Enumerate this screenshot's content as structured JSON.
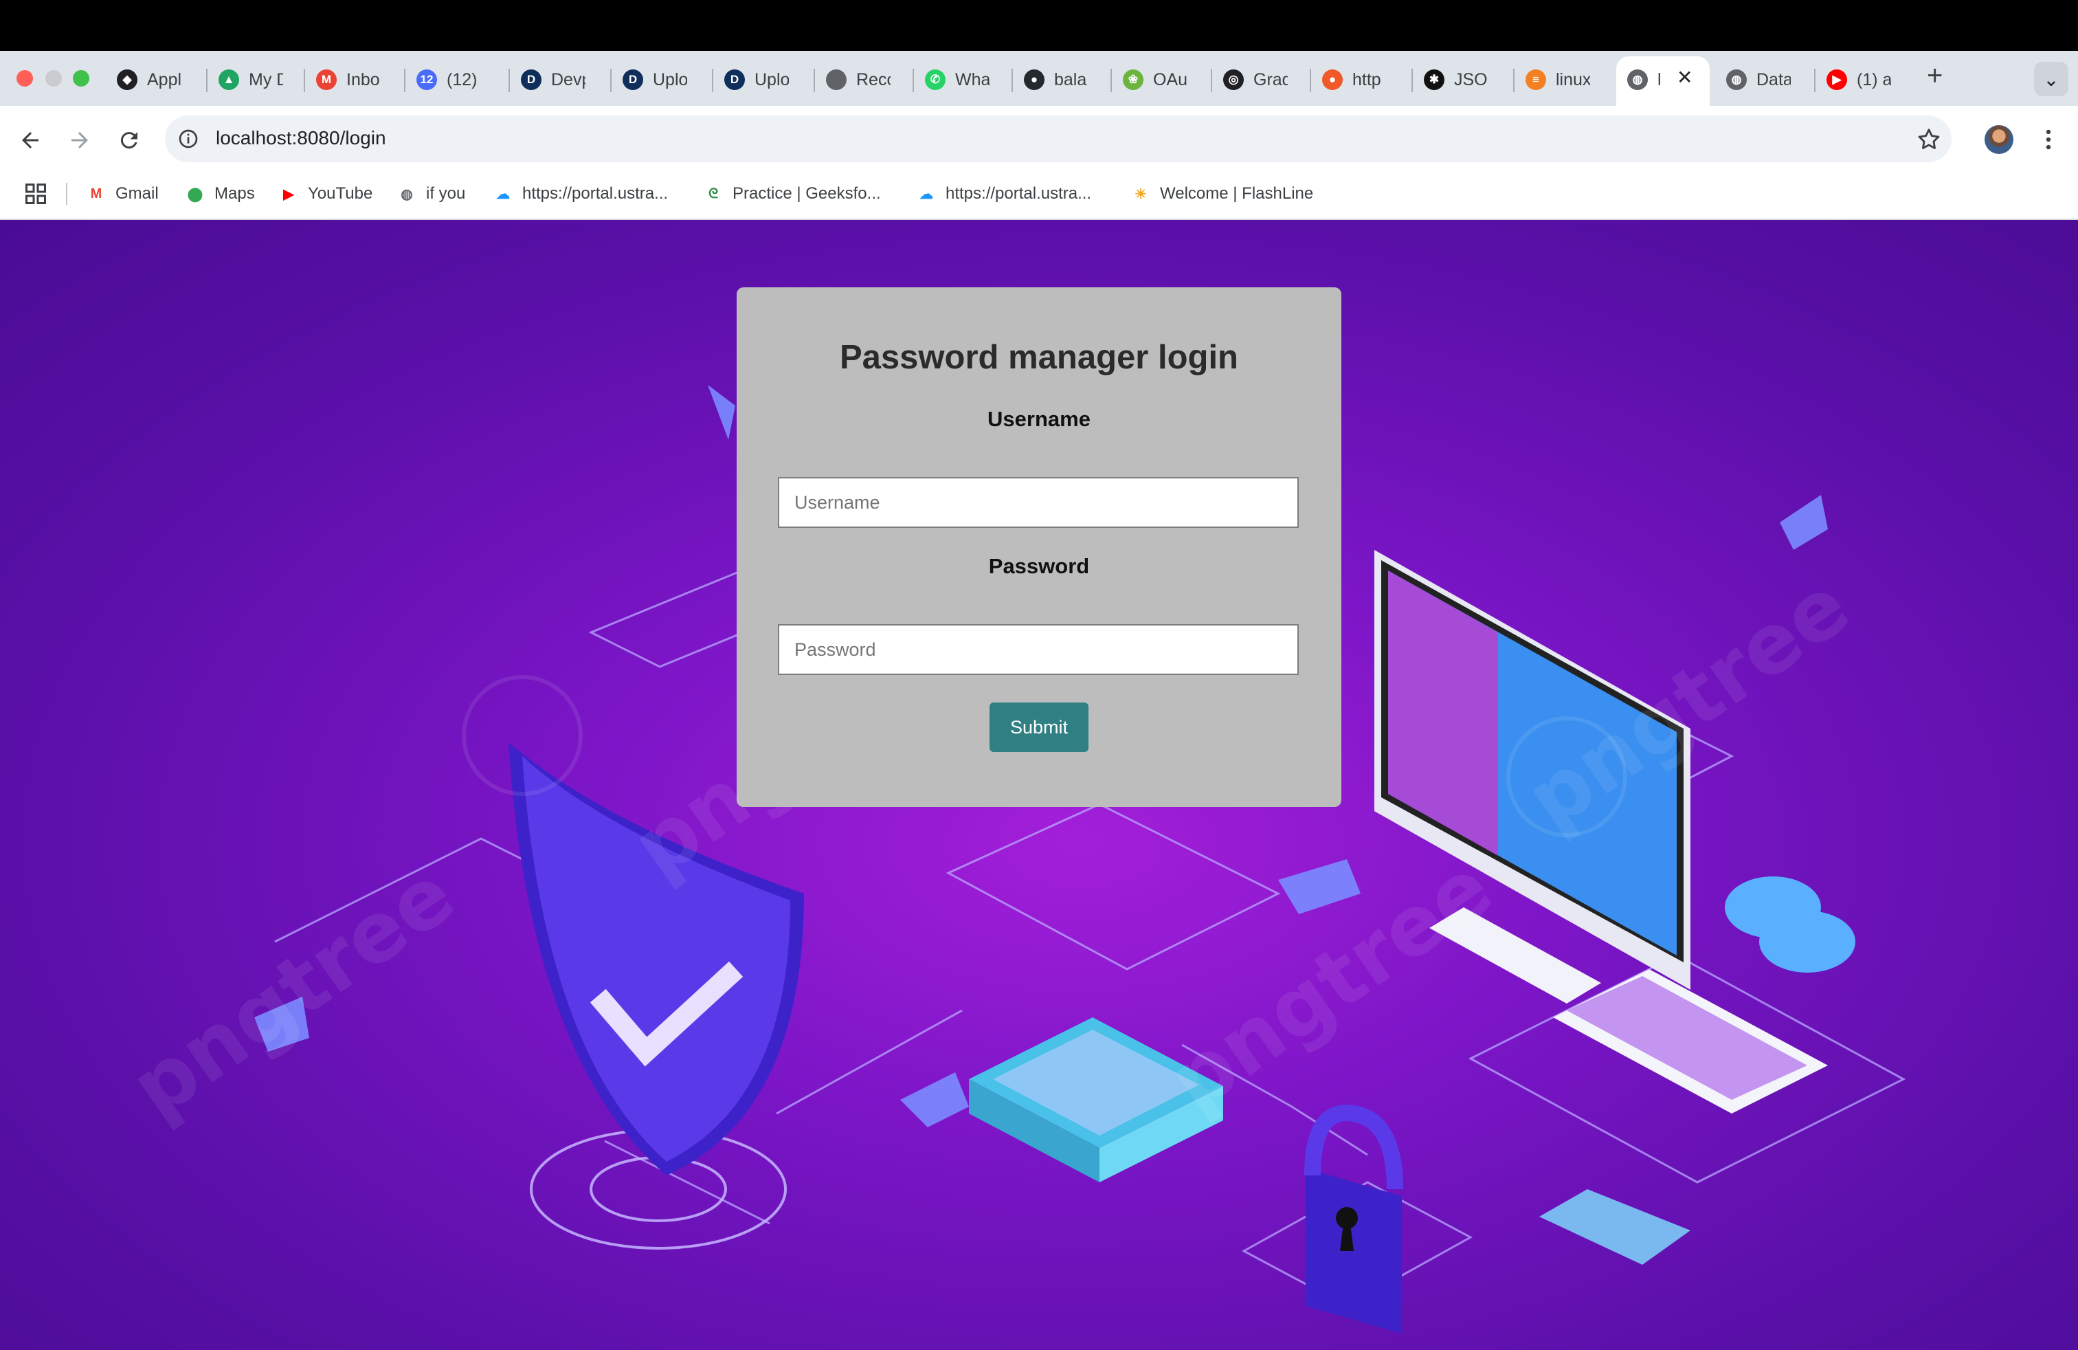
{
  "browser": {
    "tabs": [
      {
        "label": "Appl",
        "fav_color": "#202124",
        "fav_glyph": "◆",
        "icon": "shield-icon"
      },
      {
        "label": "My D",
        "fav_color": "#1fa463",
        "fav_glyph": "▲",
        "icon": "drive-icon"
      },
      {
        "label": "Inbo",
        "fav_color": "#ea4335",
        "fav_glyph": "M",
        "icon": "gmail-icon"
      },
      {
        "label": "(12)",
        "fav_color": "#4a6cf7",
        "fav_glyph": "12",
        "icon": "notification-icon"
      },
      {
        "label": "Devp",
        "fav_color": "#0f2e5a",
        "fav_glyph": "D",
        "icon": "d-icon"
      },
      {
        "label": "Uplo",
        "fav_color": "#0f2e5a",
        "fav_glyph": "D",
        "icon": "d-icon"
      },
      {
        "label": "Uplo",
        "fav_color": "#0f2e5a",
        "fav_glyph": "D",
        "icon": "d-icon"
      },
      {
        "label": "Reco",
        "fav_color": "#5f6368",
        "fav_glyph": "",
        "icon": "apple-icon"
      },
      {
        "label": "Wha",
        "fav_color": "#25d366",
        "fav_glyph": "✆",
        "icon": "whatsapp-icon"
      },
      {
        "label": "bala",
        "fav_color": "#24292e",
        "fav_glyph": "●",
        "icon": "github-icon"
      },
      {
        "label": "OAut",
        "fav_color": "#6db33f",
        "fav_glyph": "❀",
        "icon": "spring-icon"
      },
      {
        "label": "Grad",
        "fav_color": "#202124",
        "fav_glyph": "◎",
        "icon": "openai-icon"
      },
      {
        "label": "http",
        "fav_color": "#f05a28",
        "fav_glyph": "●",
        "icon": "postman-icon"
      },
      {
        "label": "JSO",
        "fav_color": "#111111",
        "fav_glyph": "✱",
        "icon": "json-icon"
      },
      {
        "label": "linux",
        "fav_color": "#f48024",
        "fav_glyph": "≡",
        "icon": "stackoverflow-icon"
      },
      {
        "label": "l",
        "fav_color": "#5f6368",
        "fav_glyph": "◍",
        "icon": "globe-icon"
      },
      {
        "label": "Data",
        "fav_color": "#5f6368",
        "fav_glyph": "◍",
        "icon": "globe-icon"
      },
      {
        "label": "(1) a",
        "fav_color": "#ff0000",
        "fav_glyph": "▶",
        "icon": "youtube-icon"
      }
    ],
    "new_tab_glyph": "+",
    "tab_menu_glyph": "⌄",
    "close_glyph": "✕",
    "url": "localhost:8080/login",
    "bookmarks": [
      {
        "label": "Gmail",
        "glyph": "M",
        "color": "#ea4335",
        "icon": "gmail-icon"
      },
      {
        "label": "Maps",
        "glyph": "⬤",
        "color": "#34a853",
        "icon": "maps-pin-icon"
      },
      {
        "label": "YouTube",
        "glyph": "▶",
        "color": "#ff0000",
        "icon": "youtube-icon"
      },
      {
        "label": "if you",
        "glyph": "◍",
        "color": "#5f6368",
        "icon": "globe-icon"
      },
      {
        "label": "https://portal.ustra...",
        "glyph": "☁",
        "color": "#1b96ff",
        "icon": "cloud-icon"
      },
      {
        "label": "Practice | Geeksfo...",
        "glyph": "ᘓ",
        "color": "#2f8d46",
        "icon": "geeksforgeeks-icon"
      },
      {
        "label": "https://portal.ustra...",
        "glyph": "☁",
        "color": "#1b96ff",
        "icon": "cloud-icon"
      },
      {
        "label": "Welcome | FlashLine",
        "glyph": "☀",
        "color": "#f4a81d",
        "icon": "sun-icon"
      }
    ]
  },
  "login": {
    "title": "Password manager login",
    "username_label": "Username",
    "username_placeholder": "Username",
    "password_label": "Password",
    "password_placeholder": "Password",
    "submit_label": "Submit",
    "submit_color": "#2f7f83"
  },
  "background": {
    "watermark": "pngtree"
  }
}
